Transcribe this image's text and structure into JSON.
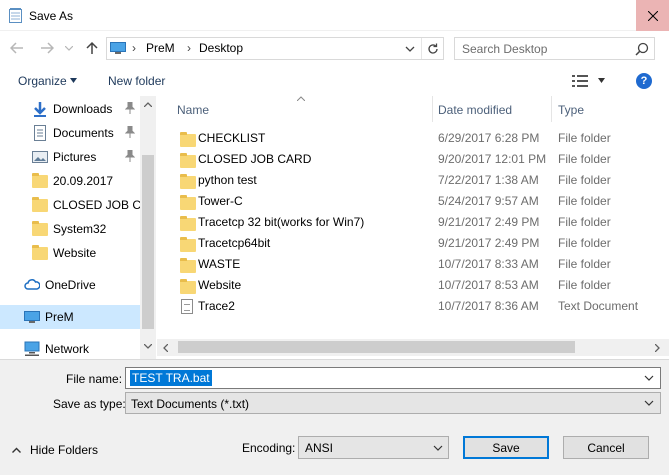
{
  "window": {
    "title": "Save As"
  },
  "navbar": {
    "breadcrumb": [
      "PreM",
      "Desktop"
    ],
    "breadcrumb_sep": "›",
    "search_placeholder": "Search Desktop"
  },
  "toolbar": {
    "organize_label": "Organize",
    "new_folder_label": "New folder",
    "help_label": "?"
  },
  "sidebar": {
    "items": [
      {
        "label": "Downloads",
        "icon": "download-arrow-icon",
        "pinned": true
      },
      {
        "label": "Documents",
        "icon": "documents-icon",
        "pinned": true
      },
      {
        "label": "Pictures",
        "icon": "pictures-icon",
        "pinned": true
      },
      {
        "label": "20.09.2017",
        "icon": "folder-icon",
        "pinned": false
      },
      {
        "label": "CLOSED JOB CA",
        "icon": "folder-icon",
        "pinned": false
      },
      {
        "label": "System32",
        "icon": "folder-icon",
        "pinned": false
      },
      {
        "label": "Website",
        "icon": "folder-icon",
        "pinned": false
      },
      {
        "label": "OneDrive",
        "icon": "cloud-icon",
        "pinned": false
      },
      {
        "label": "PreM",
        "icon": "computer-icon",
        "pinned": false,
        "selected": true
      },
      {
        "label": "Network",
        "icon": "network-icon",
        "pinned": false
      }
    ]
  },
  "filelist": {
    "columns": {
      "name": "Name",
      "date": "Date modified",
      "type": "Type"
    },
    "rows": [
      {
        "name": "CHECKLIST",
        "date": "6/29/2017 6:28 PM",
        "type": "File folder",
        "icon": "folder-icon"
      },
      {
        "name": "CLOSED JOB CARD",
        "date": "9/20/2017 12:01 PM",
        "type": "File folder",
        "icon": "folder-icon"
      },
      {
        "name": "python test",
        "date": "7/22/2017 1:38 AM",
        "type": "File folder",
        "icon": "folder-icon"
      },
      {
        "name": "Tower-C",
        "date": "5/24/2017 9:57 AM",
        "type": "File folder",
        "icon": "folder-icon"
      },
      {
        "name": "Tracetcp 32 bit(works for Win7)",
        "date": "9/21/2017 2:49 PM",
        "type": "File folder",
        "icon": "folder-icon"
      },
      {
        "name": "Tracetcp64bit",
        "date": "9/21/2017 2:49 PM",
        "type": "File folder",
        "icon": "folder-icon"
      },
      {
        "name": "WASTE",
        "date": "10/7/2017 8:33 AM",
        "type": "File folder",
        "icon": "folder-icon"
      },
      {
        "name": "Website",
        "date": "10/7/2017 8:53 AM",
        "type": "File folder",
        "icon": "folder-icon"
      },
      {
        "name": "Trace2",
        "date": "10/7/2017 8:36 AM",
        "type": "Text Document",
        "icon": "text-document-icon"
      }
    ]
  },
  "form": {
    "file_name_label": "File name:",
    "file_name_value": "TEST TRA.bat",
    "save_type_label": "Save as type:",
    "save_type_value": "Text Documents (*.txt)",
    "encoding_label": "Encoding:",
    "encoding_value": "ANSI",
    "hide_folders_label": "Hide Folders",
    "save_label": "Save",
    "cancel_label": "Cancel"
  },
  "colors": {
    "accent": "#0078d7",
    "close_bg": "#ebb4b4",
    "selected_row": "#cce8ff",
    "folder": "#f8d775"
  }
}
